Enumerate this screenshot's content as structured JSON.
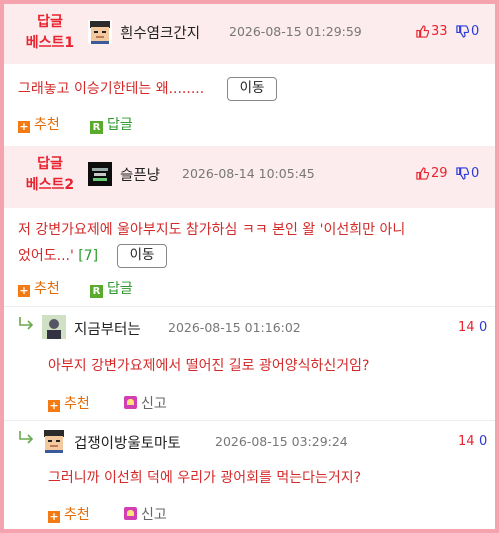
{
  "comments": [
    {
      "best_label_1": "답글",
      "best_label_2": "베스트1",
      "nickname": "흰수염크간지",
      "date": "2026-08-15 01:29:59",
      "up": "33",
      "down": "0",
      "text": "그래놓고 이승기한테는 왜........",
      "move_label": "이동",
      "recommend_label": "추천",
      "reply_label": "답글"
    },
    {
      "best_label_1": "답글",
      "best_label_2": "베스트2",
      "nickname": "슬픈냥",
      "date": "2026-08-14 10:05:45",
      "up": "29",
      "down": "0",
      "text_line1": "저 강변가요제에 울아부지도 참가하심 ㅋㅋ 본인 왈 '이선희만 아니",
      "text_line2": "었어도...'",
      "reply_count": "[7]",
      "move_label": "이동",
      "recommend_label": "추천",
      "reply_label": "답글"
    }
  ],
  "replies": [
    {
      "nickname": "지금부터는",
      "date": "2026-08-15 01:16:02",
      "up": "14",
      "down": "0",
      "text": "아부지 강변가요제에서 떨어진 길로 광어양식하신거임?",
      "recommend_label": "추천",
      "report_label": "신고"
    },
    {
      "nickname": "겁쟁이방울토마토",
      "date": "2026-08-15 03:29:24",
      "up": "14",
      "down": "0",
      "text": "그러니까 이선희 덕에 우리가 광어회를 먹는다는거지?",
      "recommend_label": "추천",
      "report_label": "신고"
    }
  ],
  "icons": {
    "thumb_up": "thumbs-up-icon",
    "thumb_down": "thumbs-down-icon",
    "recommend": "plus-icon",
    "reply": "reply-r-icon",
    "report": "report-icon",
    "reply_arrow": "reply-arrow-icon"
  },
  "colors": {
    "border": "#f5a3ae",
    "best_bg": "#fdecee",
    "accent_red": "#e8242f",
    "down_blue": "#2a3bd6",
    "recommend_orange": "#e36c0a",
    "reply_green": "#2e9a2e"
  }
}
